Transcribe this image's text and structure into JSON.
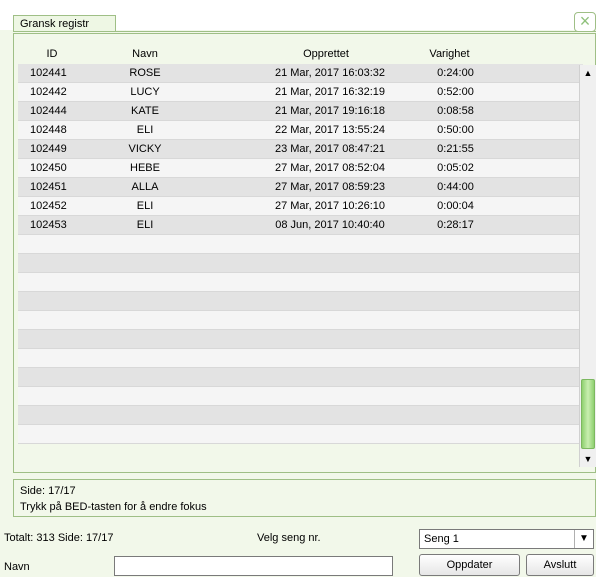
{
  "window": {
    "title": "Gransk registr",
    "close_glyph": "×"
  },
  "table": {
    "columns": [
      "ID",
      "Navn",
      "Opprettet",
      "Varighet"
    ],
    "rows": [
      [
        "102441",
        "ROSE",
        "21 Mar, 2017 16:03:32",
        "0:24:00"
      ],
      [
        "102442",
        "LUCY",
        "21 Mar, 2017 16:32:19",
        "0:52:00"
      ],
      [
        "102444",
        "KATE",
        "21 Mar, 2017 19:16:18",
        "0:08:58"
      ],
      [
        "102448",
        "ELI",
        "22 Mar, 2017 13:55:24",
        "0:50:00"
      ],
      [
        "102449",
        "VICKY",
        "23 Mar, 2017 08:47:21",
        "0:21:55"
      ],
      [
        "102450",
        "HEBE",
        "27 Mar, 2017 08:52:04",
        "0:05:02"
      ],
      [
        "102451",
        "ALLA",
        "27 Mar, 2017 08:59:23",
        "0:44:00"
      ],
      [
        "102452",
        "ELI",
        "27 Mar, 2017 10:26:10",
        "0:00:04"
      ],
      [
        "102453",
        "ELI",
        "08 Jun, 2017 10:40:40",
        "0:28:17"
      ]
    ],
    "empty_row_count": 11
  },
  "scrollbar": {
    "up_glyph": "▲",
    "down_glyph": "▼"
  },
  "info": {
    "page": "Side: 17/17",
    "hint": "Trykk på BED-tasten for å endre fokus"
  },
  "footer": {
    "total": "Totalt: 313 Side: 17/17",
    "bed_label": "Velg seng nr.",
    "bed_select_value": "Seng 1",
    "select_arrow_glyph": "▼",
    "name_label": "Navn",
    "name_value": "",
    "update_button": "Oppdater",
    "exit_button": "Avslutt"
  },
  "colors": {
    "background": "#f2f8ea",
    "frame_border": "#9fbf86",
    "row_odd": "#e3e3e3",
    "row_even": "#f5f5f5",
    "scroll_thumb": "#8fd070"
  }
}
